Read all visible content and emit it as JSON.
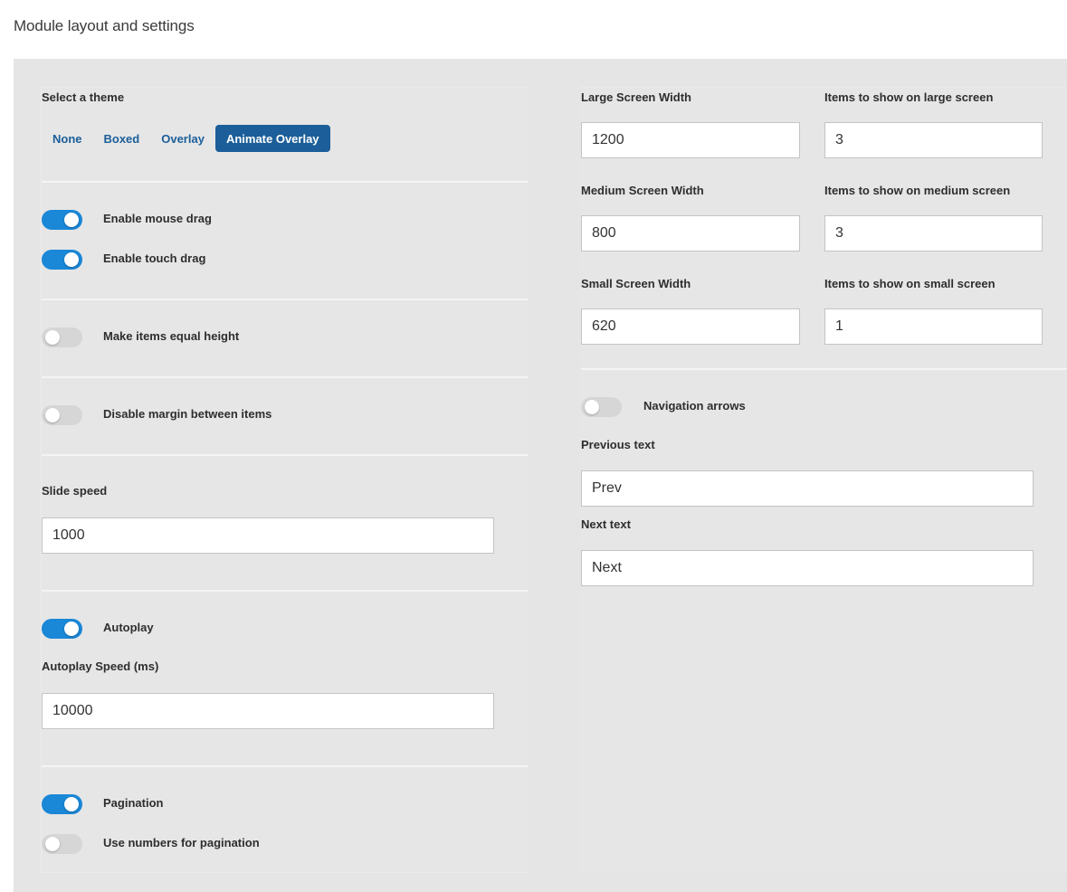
{
  "page": {
    "title": "Module layout and settings"
  },
  "left": {
    "theme": {
      "label": "Select a theme",
      "options": [
        {
          "label": "None",
          "active": false
        },
        {
          "label": "Boxed",
          "active": false
        },
        {
          "label": "Overlay",
          "active": false
        },
        {
          "label": "Animate Overlay",
          "active": true
        }
      ]
    },
    "toggles": {
      "mouse_drag": {
        "label": "Enable mouse drag",
        "on": true
      },
      "touch_drag": {
        "label": "Enable touch drag",
        "on": true
      },
      "equal_height": {
        "label": "Make items equal height",
        "on": false
      },
      "disable_margin": {
        "label": "Disable margin between items",
        "on": false
      },
      "autoplay": {
        "label": "Autoplay",
        "on": true
      },
      "pagination": {
        "label": "Pagination",
        "on": true
      },
      "numbers_pagination": {
        "label": "Use numbers for pagination",
        "on": false
      }
    },
    "slide_speed": {
      "label": "Slide speed",
      "value": "1000"
    },
    "autoplay_speed": {
      "label": "Autoplay Speed (ms)",
      "value": "10000"
    }
  },
  "right": {
    "large_width": {
      "label": "Large Screen Width",
      "value": "1200"
    },
    "large_items": {
      "label": "Items to show on large screen",
      "value": "3"
    },
    "medium_width": {
      "label": "Medium Screen Width",
      "value": "800"
    },
    "medium_items": {
      "label": "Items to show on medium screen",
      "value": "3"
    },
    "small_width": {
      "label": "Small Screen Width",
      "value": "620"
    },
    "small_items": {
      "label": "Items to show on small screen",
      "value": "1"
    },
    "nav_arrows": {
      "label": "Navigation arrows",
      "on": false
    },
    "prev_text": {
      "label": "Previous text",
      "value": "Prev"
    },
    "next_text": {
      "label": "Next text",
      "value": "Next"
    }
  },
  "colors": {
    "accent": "#1b5e99",
    "toggle_on": "#1a87d7",
    "toggle_off": "#d6d6d6",
    "panel_bg": "#e5e5e5"
  }
}
